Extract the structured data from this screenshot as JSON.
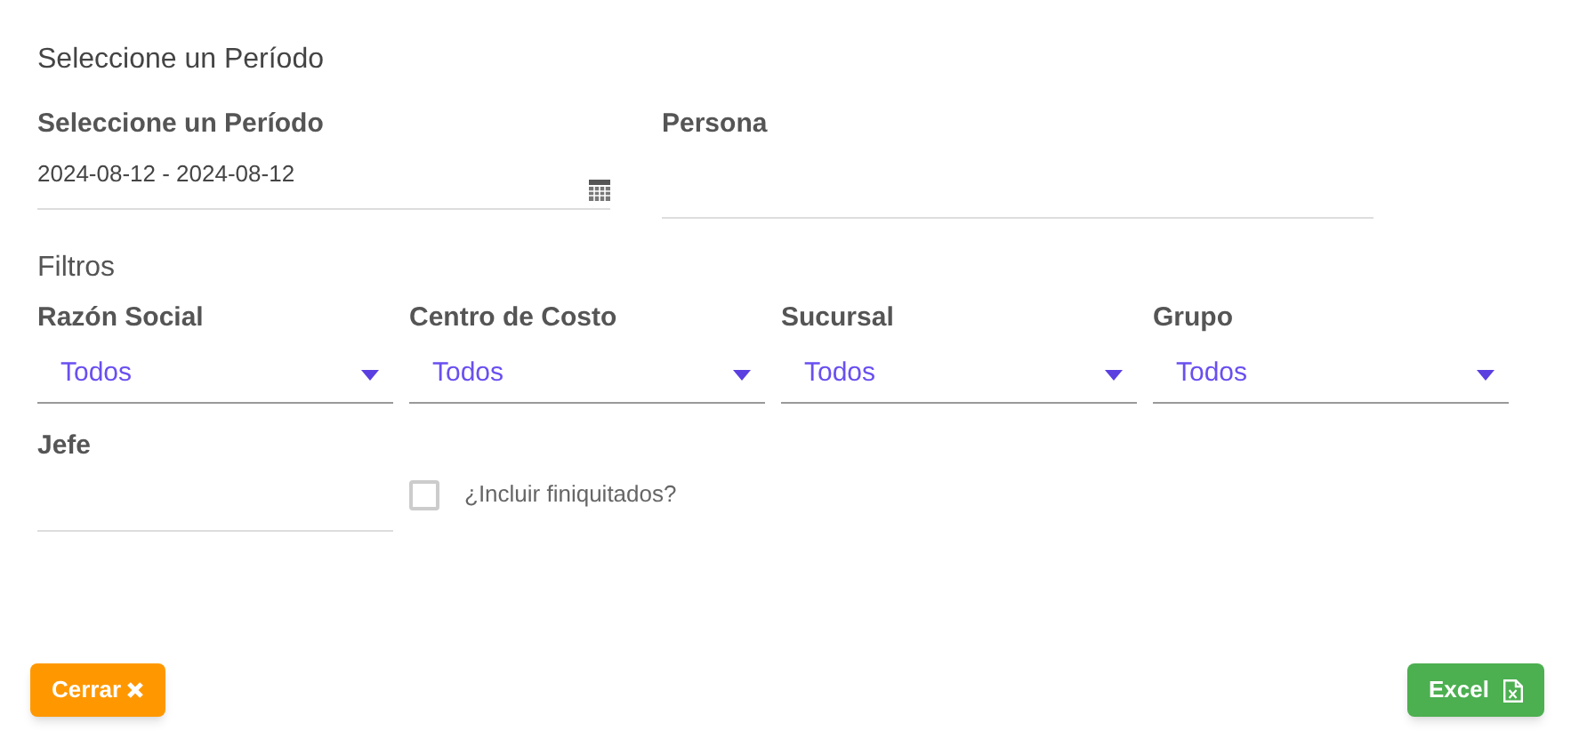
{
  "title": "Seleccione un Período",
  "period": {
    "label": "Seleccione un Período",
    "value": "2024-08-12 - 2024-08-12"
  },
  "persona": {
    "label": "Persona"
  },
  "filters_heading": "Filtros",
  "filters": [
    {
      "label": "Razón Social",
      "value": "Todos"
    },
    {
      "label": "Centro de Costo",
      "value": "Todos"
    },
    {
      "label": "Sucursal",
      "value": "Todos"
    },
    {
      "label": "Grupo",
      "value": "Todos"
    }
  ],
  "jefe": {
    "label": "Jefe"
  },
  "include_settled": {
    "label": "¿Incluir finiquitados?",
    "checked": false
  },
  "buttons": [
    {
      "kind": "close",
      "label": "Cerrar"
    },
    {
      "kind": "excel",
      "label": "Excel"
    }
  ]
}
